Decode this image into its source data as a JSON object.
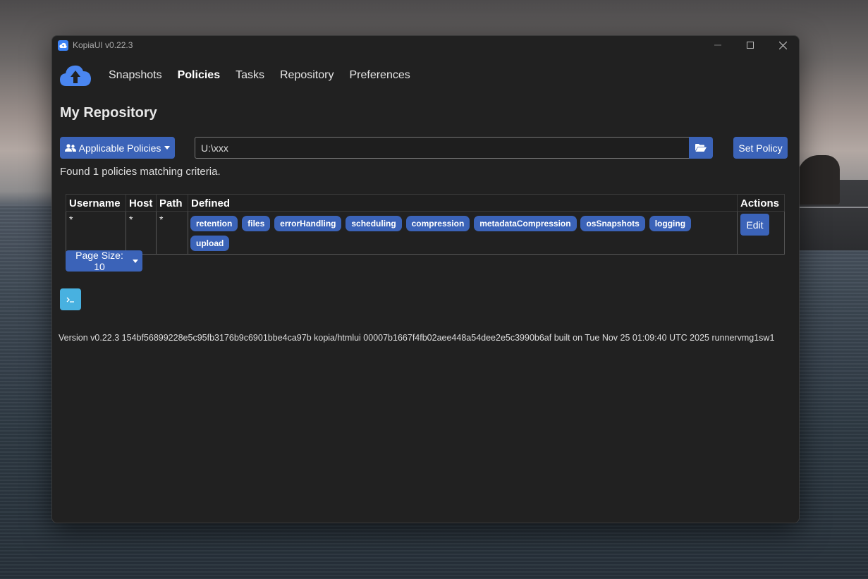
{
  "window": {
    "title": "KopiaUI v0.22.3"
  },
  "nav": {
    "items": [
      {
        "label": "Snapshots"
      },
      {
        "label": "Policies"
      },
      {
        "label": "Tasks"
      },
      {
        "label": "Repository"
      },
      {
        "label": "Preferences"
      }
    ],
    "active": "Policies"
  },
  "page": {
    "title": "My Repository"
  },
  "controls": {
    "applicable_label": "Applicable Policies",
    "path_value": "U:\\xxx",
    "set_policy_label": "Set Policy"
  },
  "found_text": "Found 1 policies matching criteria.",
  "table": {
    "headers": {
      "username": "Username",
      "host": "Host",
      "path": "Path",
      "defined": "Defined",
      "actions": "Actions"
    },
    "rows": [
      {
        "username": "*",
        "host": "*",
        "path": "*",
        "defined": [
          "retention",
          "files",
          "errorHandling",
          "scheduling",
          "compression",
          "metadataCompression",
          "osSnapshots",
          "logging",
          "upload"
        ],
        "action": "Edit"
      }
    ]
  },
  "page_size_label": "Page Size: 10",
  "version_text": "Version v0.22.3 154bf56899228e5c95fb3176b9c6901bbe4ca97b kopia/htmlui 00007b1667f4fb02aee448a54dee2e5c3990b6af built on Tue Nov 25 01:09:40 UTC 2025 runnervmg1sw1",
  "colors": {
    "accent": "#3b63b8",
    "terminal": "#48b1e0",
    "background": "#212121"
  },
  "icons": [
    "kopia-logo-icon",
    "users-icon",
    "folder-open-icon",
    "terminal-icon",
    "minimize-icon",
    "maximize-icon",
    "close-icon"
  ]
}
